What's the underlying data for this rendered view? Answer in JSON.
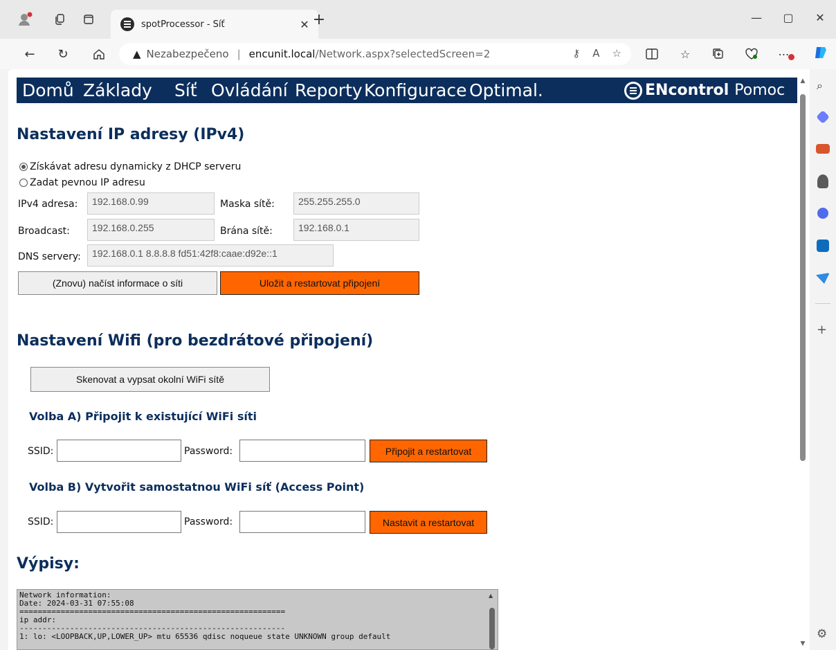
{
  "browser": {
    "tab_title": "spotProcessor - Síť",
    "address": {
      "warning_label": "Nezabezpečeno",
      "host": "encunit.local",
      "path": "/Network.aspx?selectedScreen=2"
    }
  },
  "menu": {
    "items": [
      "Domů",
      "Základy",
      "Síť",
      "Ovládání",
      "Reporty",
      "Konfigurace",
      "Optimal."
    ],
    "brand": "ENcontrol",
    "help": "Pomoc"
  },
  "ipv4": {
    "heading": "Nastavení IP adresy (IPv4)",
    "radio_dhcp": "Získávat adresu dynamicky z DHCP serveru",
    "radio_static": "Zadat pevnou IP adresu",
    "ipv4_label": "IPv4 adresa:",
    "ipv4_value": "192.168.0.99",
    "mask_label": "Maska sítě:",
    "mask_value": "255.255.255.0",
    "broadcast_label": "Broadcast:",
    "broadcast_value": "192.168.0.255",
    "gateway_label": "Brána sítě:",
    "gateway_value": "192.168.0.1",
    "dns_label": "DNS servery:",
    "dns_value": "192.168.0.1 8.8.8.8 fd51:42f8:caae:d92e::1",
    "reload_button": "(Znovu) načíst informace o síti",
    "save_button": "Uložit a restartovat připojení"
  },
  "wifi": {
    "heading": "Nastavení Wifi (pro bezdrátové připojení)",
    "scan_button": "Skenovat a vypsat okolní WiFi sítě",
    "option_a": {
      "heading": "Volba A) Připojit k existující WiFi síti",
      "ssid_label": "SSID:",
      "password_label": "Password:",
      "button": "Připojit a restartovat"
    },
    "option_b": {
      "heading": "Volba B) Vytvořit samostatnou WiFi síť (Access Point)",
      "ssid_label": "SSID:",
      "password_label": "Password:",
      "button": "Nastavit a restartovat"
    }
  },
  "logs": {
    "heading": "Výpisy:",
    "text": "Network information:\nDate: 2024-03-31 07:55:08\n==========================================================\nip addr:\n----------------------------------------------------------\n1: lo: <LOOPBACK,UP,LOWER_UP> mtu 65536 qdisc noqueue state UNKNOWN group default"
  },
  "colors": {
    "menu_bg": "#0c2e5c",
    "heading": "#0c2e5c",
    "accent_button": "#ff6600"
  }
}
